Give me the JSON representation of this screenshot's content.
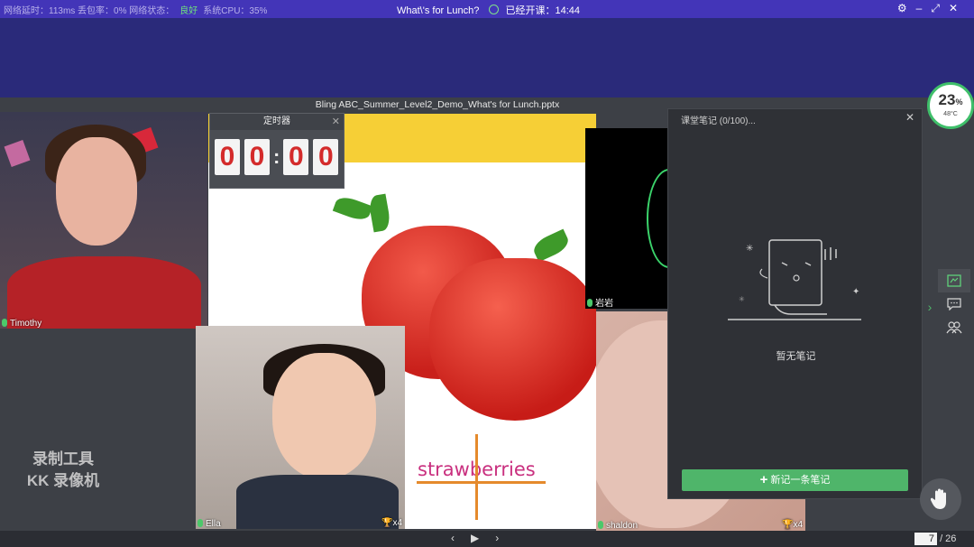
{
  "topbar": {
    "stats": "网络延时：113ms 丢包率：0% 网络状态：",
    "net_status": "良好",
    "cpu": "系统CPU：35%",
    "lesson_title": "What\\'s for Lunch?",
    "started_label": "已经开课：14:44"
  },
  "slide": {
    "file_name": "Bling ABC_Summer_Level2_Demo_What's for Lunch.pptx",
    "word": "strawberries"
  },
  "timer": {
    "title": "定时器",
    "digits": [
      "0",
      "0",
      "0",
      "0"
    ]
  },
  "participants": {
    "timothy": "Timothy",
    "ella": "Ella",
    "ella_trophies": "x4",
    "yanyan": "岩岩",
    "shaldon": "shaldon",
    "shaldon_trophies": "x4"
  },
  "notes": {
    "title": "课堂笔记 (0/100)...",
    "empty_text": "暂无笔记",
    "add_label": "新记一条笔记"
  },
  "gauge": {
    "percent": "23",
    "percent_unit": "%",
    "temp": "48°C"
  },
  "pagination": {
    "current": "7",
    "total": "/ 26"
  },
  "watermark": {
    "line1": "录制工具",
    "line2": "KK 录像机"
  }
}
